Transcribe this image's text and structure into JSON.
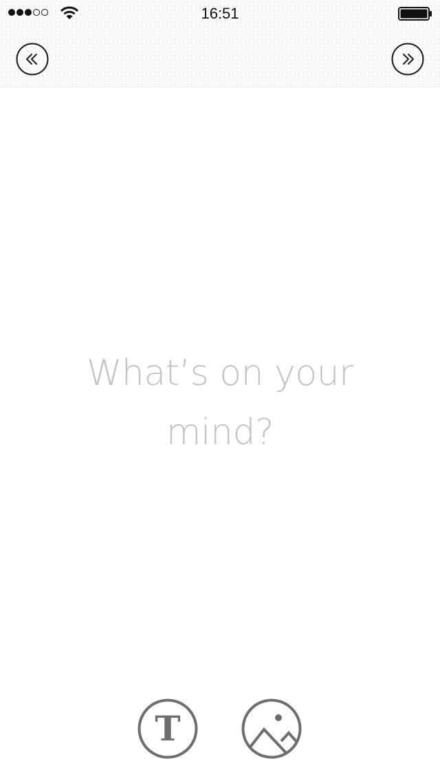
{
  "status_bar": {
    "time": "16:51",
    "signal_filled": 3,
    "signal_total": 5,
    "wifi_icon": "wifi-icon",
    "battery_icon": "battery-icon",
    "battery_level": 1.0
  },
  "nav": {
    "back_icon": "double-chevron-left-icon",
    "forward_icon": "double-chevron-right-icon"
  },
  "main": {
    "prompt": "What’s on your mind?"
  },
  "toolbar": {
    "text_label": "T",
    "text_icon": "text-icon",
    "image_icon": "image-icon"
  },
  "colors": {
    "accent": "#6e6e6e",
    "prompt": "#c4c4c4",
    "nav": "#1a1a1a"
  }
}
